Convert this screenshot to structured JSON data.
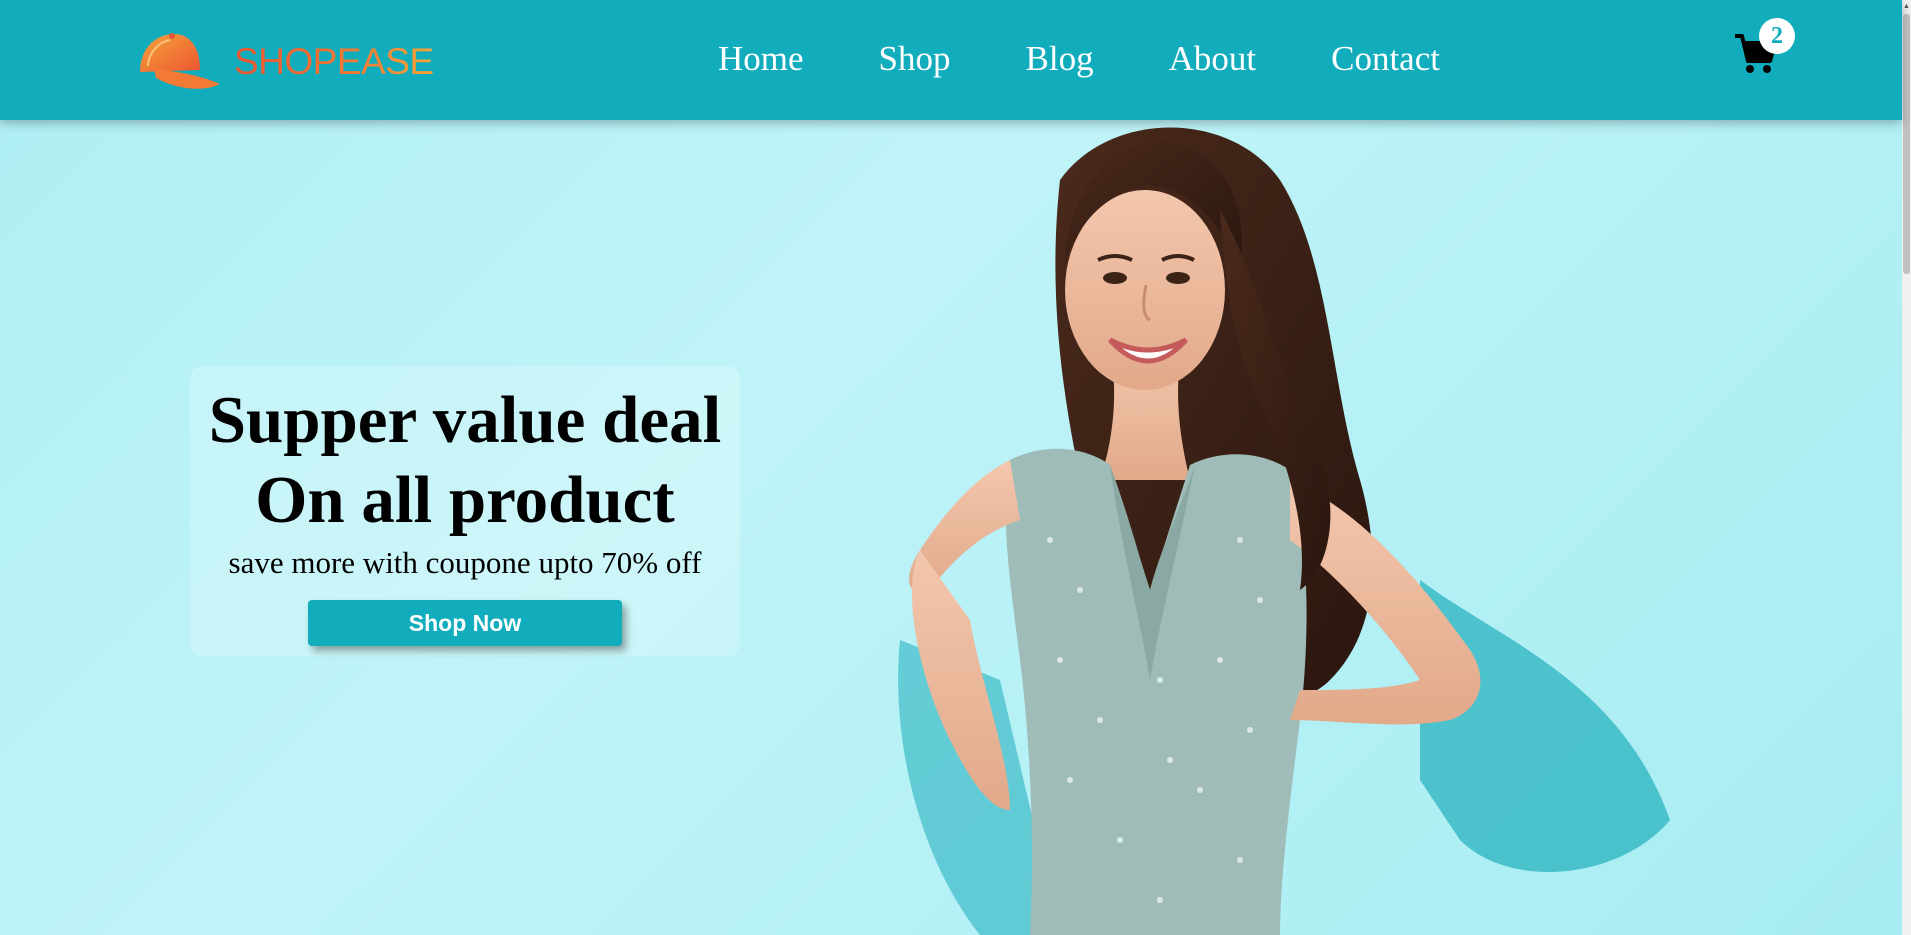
{
  "brand": {
    "logo_text": "SHOPEASE",
    "icon": "cap-logo-icon"
  },
  "nav": {
    "items": [
      {
        "label": "Home"
      },
      {
        "label": "Shop"
      },
      {
        "label": "Blog"
      },
      {
        "label": "About"
      },
      {
        "label": "Contact"
      }
    ]
  },
  "cart": {
    "icon": "cart-icon",
    "count": "2"
  },
  "hero": {
    "title_line1": "Supper value deal",
    "title_line2": "On all product",
    "subtitle": "save more with coupone upto 70% off",
    "button_label": "Shop Now"
  },
  "colors": {
    "accent": "#11adbd",
    "background": "#b5f0f6",
    "logo_gradient": [
      "#ec5532",
      "#f6a53a"
    ]
  }
}
